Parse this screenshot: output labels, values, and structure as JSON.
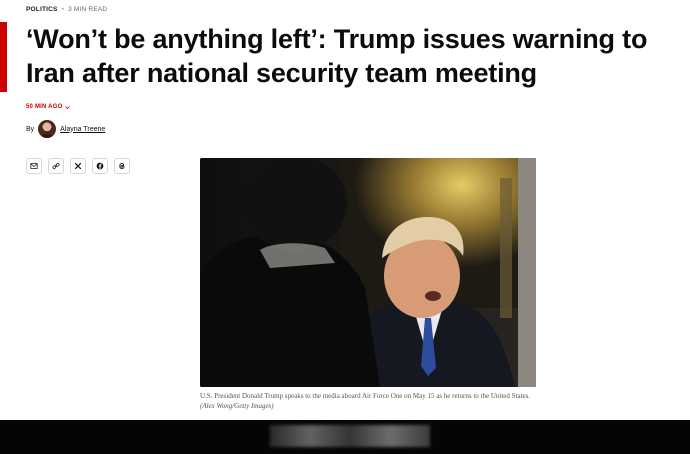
{
  "article": {
    "section": "POLITICS",
    "separator": "•",
    "read_time": "3 MIN READ",
    "headline": "‘Won’t be anything left’: Trump issues warning to Iran after national security team meeting",
    "timestamp": "50 MIN AGO",
    "byline_prefix": "By",
    "author": "Alayna Treene"
  },
  "share": {
    "items": [
      {
        "icon": "email-icon"
      },
      {
        "icon": "link-icon"
      },
      {
        "icon": "x-icon"
      },
      {
        "icon": "facebook-icon"
      },
      {
        "icon": "threads-icon"
      }
    ]
  },
  "photo": {
    "caption": "U.S. President Donald Trump speaks to the media aboard Air Force One on May 15 as he returns to the United States.",
    "credit": "(Alex Wong/Getty Images)"
  },
  "colors": {
    "accent": "#cc0000",
    "headline": "#0c0c0c",
    "caption": "#555555"
  }
}
